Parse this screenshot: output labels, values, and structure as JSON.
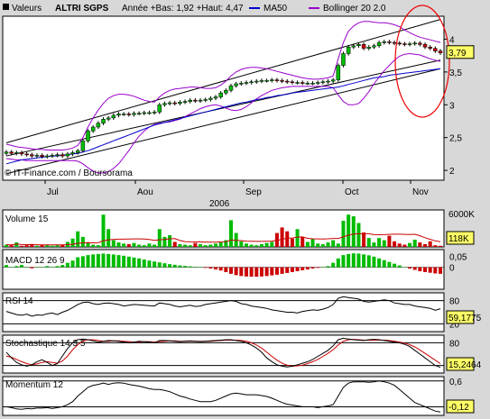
{
  "header": {
    "instrument_label": "Valeurs",
    "ticker": "ALTRI SGPS",
    "range_text": "Année +Bas: 1,92 +Haut: 4,47",
    "legend": [
      {
        "name": "MA50",
        "color": "#0000cc"
      },
      {
        "name": "Bollinger 20 2.0",
        "color": "#9900cc"
      }
    ]
  },
  "chart_data": [
    {
      "type": "candlestick",
      "title": "ALTRI SGPS",
      "x_months": [
        "Jul",
        "Aou",
        "Sep",
        "Oct",
        "Nov"
      ],
      "year_label": "2006",
      "yticks": [
        "2",
        "2,5",
        "3",
        "3,5",
        "4"
      ],
      "ylim": [
        1.85,
        4.35
      ],
      "last_value": "3,79",
      "closes": [
        2.28,
        2.26,
        2.27,
        2.25,
        2.24,
        2.22,
        2.23,
        2.21,
        2.22,
        2.23,
        2.24,
        2.22,
        2.25,
        2.27,
        2.3,
        2.45,
        2.6,
        2.66,
        2.72,
        2.78,
        2.8,
        2.84,
        2.86,
        2.86,
        2.85,
        2.87,
        2.87,
        2.88,
        2.88,
        2.89,
        3.0,
        3.02,
        3.03,
        3.02,
        3.04,
        3.05,
        3.07,
        3.06,
        3.07,
        3.08,
        3.1,
        3.12,
        3.18,
        3.22,
        3.29,
        3.32,
        3.33,
        3.34,
        3.35,
        3.36,
        3.37,
        3.37,
        3.38,
        3.37,
        3.36,
        3.35,
        3.34,
        3.34,
        3.33,
        3.33,
        3.33,
        3.34,
        3.35,
        3.36,
        3.38,
        3.6,
        3.78,
        3.88,
        3.9,
        3.92,
        3.86,
        3.88,
        3.9,
        3.95,
        3.96,
        3.95,
        3.94,
        3.93,
        3.92,
        3.93,
        3.94,
        3.92,
        3.88,
        3.86,
        3.82,
        3.79
      ],
      "ma50": [
        2.1,
        2.12,
        2.14,
        2.16,
        2.17,
        2.18,
        2.19,
        2.2,
        2.21,
        2.22,
        2.22,
        2.23,
        2.24,
        2.25,
        2.26,
        2.28,
        2.3,
        2.33,
        2.36,
        2.39,
        2.42,
        2.45,
        2.48,
        2.51,
        2.54,
        2.57,
        2.6,
        2.63,
        2.66,
        2.69,
        2.71,
        2.73,
        2.75,
        2.77,
        2.79,
        2.81,
        2.83,
        2.85,
        2.87,
        2.89,
        2.91,
        2.93,
        2.95,
        2.97,
        2.99,
        3.01,
        3.03,
        3.04,
        3.06,
        3.08,
        3.09,
        3.11,
        3.12,
        3.14,
        3.15,
        3.16,
        3.18,
        3.19,
        3.2,
        3.21,
        3.22,
        3.23,
        3.24,
        3.25,
        3.26,
        3.27,
        3.29,
        3.31,
        3.33,
        3.35,
        3.37,
        3.39,
        3.41,
        3.42,
        3.43,
        3.45,
        3.46,
        3.47,
        3.48,
        3.49,
        3.5,
        3.51,
        3.52,
        3.53,
        3.54,
        3.55
      ],
      "bollinger_upper": [
        2.4,
        2.38,
        2.36,
        2.35,
        2.34,
        2.33,
        2.32,
        2.32,
        2.31,
        2.31,
        2.31,
        2.31,
        2.32,
        2.34,
        2.38,
        2.5,
        2.66,
        2.8,
        2.92,
        3.02,
        3.1,
        3.14,
        3.16,
        3.16,
        3.15,
        3.13,
        3.1,
        3.07,
        3.05,
        3.04,
        3.12,
        3.18,
        3.22,
        3.24,
        3.25,
        3.26,
        3.27,
        3.27,
        3.26,
        3.25,
        3.25,
        3.26,
        3.3,
        3.36,
        3.44,
        3.5,
        3.54,
        3.56,
        3.57,
        3.57,
        3.56,
        3.55,
        3.53,
        3.51,
        3.49,
        3.47,
        3.45,
        3.43,
        3.41,
        3.4,
        3.39,
        3.39,
        3.4,
        3.41,
        3.44,
        3.7,
        3.95,
        4.12,
        4.2,
        4.25,
        4.27,
        4.27,
        4.26,
        4.25,
        4.25,
        4.24,
        4.22,
        4.19,
        4.14,
        4.1,
        4.06,
        4.03,
        4.01,
        3.99,
        3.97,
        3.95
      ],
      "bollinger_lower": [
        2.18,
        2.17,
        2.16,
        2.16,
        2.15,
        2.15,
        2.15,
        2.15,
        2.15,
        2.15,
        2.15,
        2.15,
        2.15,
        2.15,
        2.14,
        2.1,
        2.04,
        1.99,
        1.96,
        1.96,
        1.98,
        2.03,
        2.1,
        2.2,
        2.3,
        2.42,
        2.52,
        2.6,
        2.66,
        2.7,
        2.72,
        2.73,
        2.74,
        2.76,
        2.78,
        2.82,
        2.86,
        2.9,
        2.94,
        2.97,
        2.99,
        3.0,
        2.98,
        2.95,
        2.92,
        2.91,
        2.93,
        2.97,
        3.03,
        3.09,
        3.14,
        3.18,
        3.22,
        3.24,
        3.26,
        3.27,
        3.28,
        3.28,
        3.28,
        3.28,
        3.28,
        3.28,
        3.28,
        3.28,
        3.26,
        3.15,
        3.05,
        3.0,
        3.0,
        3.02,
        3.1,
        3.2,
        3.32,
        3.42,
        3.52,
        3.6,
        3.68,
        3.74,
        3.77,
        3.78,
        3.77,
        3.76,
        3.73,
        3.7,
        3.68,
        3.66
      ],
      "annotation": "© IT-Finance.com / Boursorama"
    },
    {
      "type": "bar",
      "title": "Volume 15",
      "yticks": [
        "6000K"
      ],
      "ymax": 6000,
      "last_value": "118K",
      "values": [
        400,
        300,
        800,
        200,
        300,
        500,
        200,
        300,
        400,
        200,
        300,
        400,
        900,
        1500,
        2800,
        1800,
        800,
        400,
        300,
        5800,
        3200,
        1200,
        800,
        600,
        500,
        700,
        400,
        300,
        600,
        400,
        3200,
        1800,
        2100,
        900,
        500,
        400,
        300,
        700,
        500,
        300,
        400,
        600,
        800,
        1200,
        4800,
        2500,
        1000,
        600,
        400,
        300,
        500,
        700,
        900,
        2500,
        3500,
        2800,
        1500,
        3200,
        1800,
        900,
        1400,
        600,
        500,
        800,
        1200,
        600,
        4700,
        5800,
        5500,
        4300,
        2600,
        1600,
        800,
        1600,
        1200,
        2000,
        1000,
        600,
        400,
        700,
        1300,
        800,
        500,
        1000,
        300,
        200
      ]
    },
    {
      "type": "bar",
      "title": "MACD 12 26 9",
      "yticks": [
        "0,05",
        "0"
      ],
      "ylim": [
        -0.1,
        0.08
      ],
      "values": [
        0.01,
        0.0,
        0.005,
        0.01,
        0.0,
        -0.005,
        0.0,
        0.0,
        0.005,
        0.0,
        0.005,
        0.01,
        0.02,
        0.03,
        0.045,
        0.05,
        0.055,
        0.058,
        0.06,
        0.062,
        0.06,
        0.058,
        0.055,
        0.052,
        0.048,
        0.044,
        0.04,
        0.035,
        0.03,
        0.026,
        0.022,
        0.018,
        0.014,
        0.011,
        0.008,
        0.006,
        0.004,
        0.002,
        0.0,
        -0.003,
        -0.006,
        -0.01,
        -0.015,
        -0.022,
        -0.03,
        -0.036,
        -0.04,
        -0.042,
        -0.043,
        -0.043,
        -0.042,
        -0.04,
        -0.037,
        -0.034,
        -0.03,
        -0.026,
        -0.022,
        -0.018,
        -0.014,
        -0.01,
        -0.006,
        -0.003,
        0.0,
        0.005,
        0.02,
        0.04,
        0.055,
        0.06,
        0.063,
        0.062,
        0.058,
        0.054,
        0.048,
        0.04,
        0.032,
        0.024,
        0.016,
        0.008,
        0.0,
        -0.006,
        -0.012,
        -0.018,
        -0.022,
        -0.025,
        -0.028,
        -0.03
      ]
    },
    {
      "type": "line",
      "title": "RSI 14",
      "yticks": [
        "80",
        "20"
      ],
      "ylim": [
        0,
        100
      ],
      "last_value": "59,1775",
      "values": [
        52,
        48,
        44,
        42,
        45,
        40,
        43,
        42,
        46,
        48,
        44,
        50,
        55,
        62,
        70,
        75,
        76,
        72,
        70,
        73,
        74,
        72,
        70,
        66,
        68,
        70,
        69,
        68,
        67,
        66,
        74,
        72,
        70,
        66,
        64,
        66,
        68,
        65,
        66,
        70,
        72,
        74,
        76,
        78,
        80,
        78,
        72,
        70,
        66,
        64,
        62,
        60,
        56,
        54,
        52,
        50,
        50,
        48,
        52,
        54,
        56,
        55,
        58,
        62,
        70,
        86,
        90,
        88,
        86,
        84,
        78,
        76,
        78,
        80,
        82,
        80,
        74,
        72,
        70,
        70,
        66,
        64,
        62,
        60,
        55,
        59
      ]
    },
    {
      "type": "line",
      "title": "Stochastique 14 3 5",
      "yticks": [
        "80",
        "20"
      ],
      "ylim": [
        0,
        100
      ],
      "last_value": "15,2464",
      "k": [
        55,
        40,
        28,
        22,
        18,
        22,
        30,
        35,
        28,
        20,
        25,
        45,
        65,
        80,
        88,
        90,
        88,
        85,
        82,
        84,
        86,
        85,
        84,
        82,
        80,
        82,
        84,
        83,
        82,
        80,
        86,
        86,
        85,
        84,
        83,
        84,
        85,
        84,
        83,
        84,
        85,
        86,
        87,
        88,
        88,
        86,
        84,
        80,
        74,
        66,
        55,
        40,
        30,
        22,
        18,
        16,
        18,
        22,
        26,
        30,
        36,
        44,
        52,
        60,
        72,
        88,
        92,
        90,
        88,
        87,
        86,
        88,
        89,
        88,
        86,
        84,
        82,
        80,
        76,
        70,
        60,
        50,
        40,
        30,
        20,
        15
      ],
      "d": [
        45,
        42,
        36,
        30,
        25,
        22,
        24,
        28,
        30,
        28,
        26,
        32,
        45,
        62,
        75,
        84,
        88,
        88,
        86,
        84,
        84,
        85,
        85,
        84,
        83,
        82,
        82,
        83,
        83,
        82,
        83,
        84,
        85,
        85,
        84,
        84,
        84,
        84,
        84,
        84,
        84,
        85,
        86,
        87,
        87,
        87,
        86,
        84,
        80,
        74,
        66,
        55,
        44,
        34,
        26,
        21,
        18,
        19,
        21,
        25,
        30,
        36,
        44,
        52,
        62,
        74,
        84,
        88,
        89,
        88,
        87,
        87,
        87,
        87,
        87,
        86,
        84,
        82,
        79,
        75,
        69,
        61,
        52,
        43,
        34,
        25
      ]
    },
    {
      "type": "line",
      "title": "Momentum 12",
      "yticks": [
        "0,6",
        "0"
      ],
      "ylim": [
        -0.2,
        0.7
      ],
      "last_value": "-0,12",
      "values": [
        0.0,
        -0.02,
        -0.05,
        -0.06,
        -0.04,
        -0.05,
        -0.03,
        -0.03,
        -0.02,
        -0.04,
        -0.02,
        0.0,
        0.05,
        0.12,
        0.25,
        0.35,
        0.45,
        0.5,
        0.52,
        0.55,
        0.52,
        0.55,
        0.56,
        0.55,
        0.52,
        0.5,
        0.48,
        0.45,
        0.42,
        0.4,
        0.4,
        0.38,
        0.35,
        0.3,
        0.25,
        0.22,
        0.18,
        0.15,
        0.12,
        0.12,
        0.12,
        0.15,
        0.2,
        0.25,
        0.3,
        0.32,
        0.3,
        0.28,
        0.28,
        0.28,
        0.26,
        0.24,
        0.2,
        0.15,
        0.1,
        0.06,
        0.04,
        0.02,
        0.0,
        0.0,
        0.0,
        -0.02,
        0.0,
        0.02,
        0.05,
        0.25,
        0.45,
        0.55,
        0.58,
        0.58,
        0.58,
        0.57,
        0.58,
        0.6,
        0.58,
        0.55,
        0.5,
        0.4,
        0.3,
        0.2,
        0.1,
        0.05,
        0.0,
        -0.05,
        -0.1,
        -0.12
      ]
    }
  ],
  "colors": {
    "bull_candle": "#00bb00",
    "bear_candle": "#cc0000",
    "plot_bg": "#ffffff",
    "frame_bg": "#d8d8d8",
    "value_box_bg": "#ffff66",
    "ellipse": "#ee0000",
    "trend_line": "#000000",
    "stoch_d": "#cc0000",
    "volume_ma": "#cc0000"
  }
}
